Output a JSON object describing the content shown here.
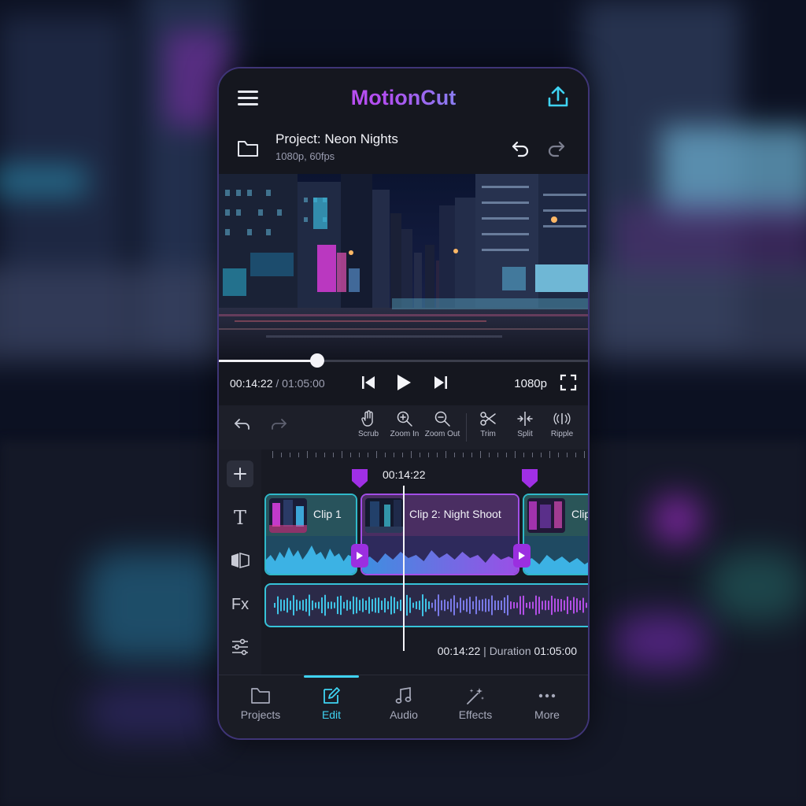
{
  "app": {
    "brand": "MotionCut"
  },
  "project": {
    "title": "Project: Neon Nights",
    "subtitle": "1080p, 60fps"
  },
  "player": {
    "current_time": "00:14:22",
    "separator": " / ",
    "total_time": "01:05:00",
    "progress": 0.265,
    "resolution": "1080p"
  },
  "toolbar": {
    "tools": [
      {
        "label": "Scrub",
        "icon": "hand-icon"
      },
      {
        "label": "Zoom In",
        "icon": "zoom-in-icon"
      },
      {
        "label": "Zoom Out",
        "icon": "zoom-out-icon"
      },
      {
        "label": "Trim",
        "icon": "scissors-icon"
      },
      {
        "label": "Split",
        "icon": "split-icon"
      },
      {
        "label": "Ripple",
        "icon": "ripple-icon"
      }
    ]
  },
  "timeline": {
    "playhead_time": "00:14:22",
    "clips": [
      {
        "name": "Clip 1"
      },
      {
        "name": "Clip 2: Night Shoot"
      },
      {
        "name": "Clip"
      }
    ],
    "status_time": "00:14:22",
    "status_sep": " | ",
    "status_label": "Duration ",
    "status_duration": "01:05:00",
    "side": {
      "text": "T",
      "fx": "Fx"
    }
  },
  "nav": [
    {
      "label": "Projects",
      "icon": "folder-icon",
      "active": false
    },
    {
      "label": "Edit",
      "icon": "edit-icon",
      "active": true
    },
    {
      "label": "Audio",
      "icon": "music-note-icon",
      "active": false
    },
    {
      "label": "Effects",
      "icon": "magic-wand-icon",
      "active": false
    },
    {
      "label": "More",
      "icon": "more-dots-icon",
      "active": false
    }
  ],
  "colors": {
    "accent_cyan": "#3fd3f2",
    "accent_purple": "#9b2fe0",
    "frame": "#15171f"
  }
}
